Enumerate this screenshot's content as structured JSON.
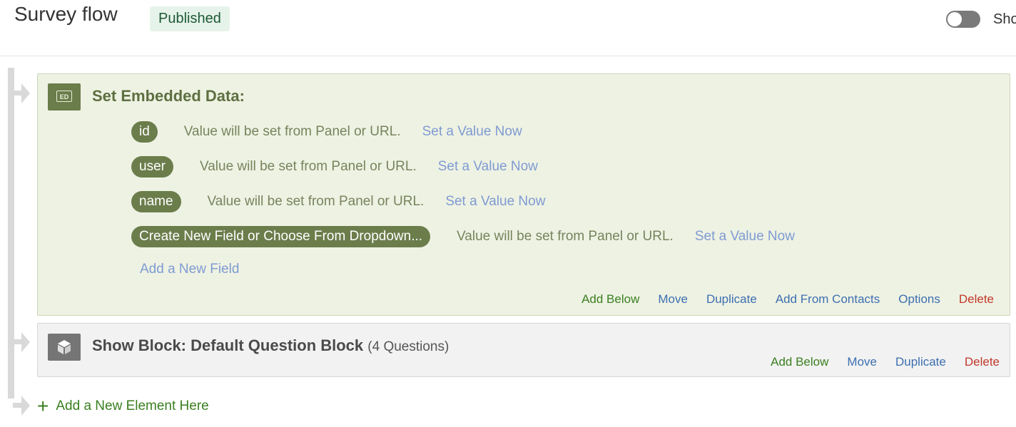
{
  "header": {
    "title": "Survey flow",
    "status": "Published",
    "toggle_label": "Sho"
  },
  "embedded_data": {
    "title": "Set Embedded Data:",
    "icon_text": "ED",
    "fields": [
      {
        "name": "id",
        "description": "Value will be set from Panel or URL.",
        "link": "Set a Value Now"
      },
      {
        "name": "user",
        "description": "Value will be set from Panel or URL.",
        "link": "Set a Value Now"
      },
      {
        "name": "name",
        "description": "Value will be set from Panel or URL.",
        "link": "Set a Value Now"
      },
      {
        "name": "Create New Field or Choose From Dropdown...",
        "description": "Value will be set from Panel or URL.",
        "link": "Set a Value Now"
      }
    ],
    "add_field": "Add a New Field",
    "actions": {
      "add_below": "Add Below",
      "move": "Move",
      "duplicate": "Duplicate",
      "add_from_contacts": "Add From Contacts",
      "options": "Options",
      "delete": "Delete"
    }
  },
  "block": {
    "title": "Show Block: Default Question Block",
    "count": "(4 Questions)",
    "actions": {
      "add_below": "Add Below",
      "move": "Move",
      "duplicate": "Duplicate",
      "delete": "Delete"
    }
  },
  "add_element": {
    "icon": "plus-icon",
    "label": "Add a New Element Here"
  },
  "colors": {
    "embedded_accent": "#6b7d4b",
    "link_blue": "#7f9bd2",
    "action_green": "#3a7f20",
    "action_red": "#c0392b"
  }
}
